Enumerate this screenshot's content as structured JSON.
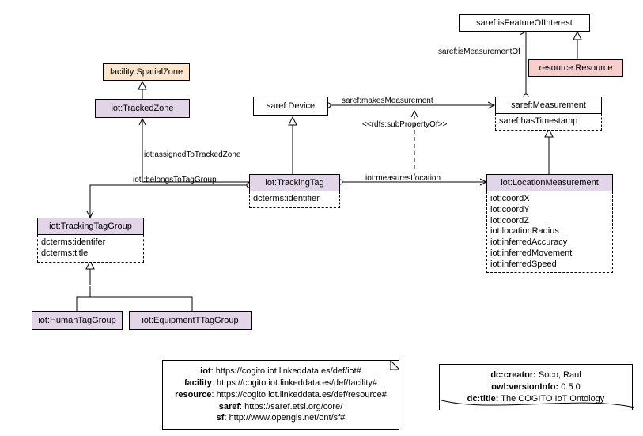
{
  "classes": {
    "spatialZone": "facility:SpatialZone",
    "trackedZone": "iot:TrackedZone",
    "device": "saref:Device",
    "trackingTag": "iot:TrackingTag",
    "trackingTagAttrs": "dcterms:identifier",
    "trackingTagGroup": "iot:TrackingTagGroup",
    "trackingTagGroupAttrs": [
      "dcterms:identifer",
      "dcterms:title"
    ],
    "humanTagGroup": "iot:HumanTagGroup",
    "equipTagGroup": "iot:EquipmentTTagGroup",
    "measurement": "saref:Measurement",
    "measurementAttr": "saref:hasTimestamp",
    "locationMeas": "iot:LocationMeasurement",
    "locationMeasAttrs": [
      "iot:coordX",
      "iot:coordY",
      "iot:coordZ",
      "iot:locationRadius",
      "iot:inferredAccuracy",
      "iot:inferredMovement",
      "iot:inferredSpeed"
    ],
    "isFeature": "saref:isFeatureOfInterest",
    "resource": "resource:Resource"
  },
  "edges": {
    "assignedToTrackedZone": "iot:assignedToTrackedZone",
    "belongsToTagGroup": "iot::belongsToTagGroup",
    "makesMeasurement": "saref:makesMeasurement",
    "subPropOf": "<<rdfs:subPropertyOf>>",
    "measuresLocation": "iot:measuresLocation",
    "isMeasurementOf": "saref:isMeasurementOf"
  },
  "namespaces": {
    "iot": {
      "prefix": "iot",
      "uri": "https://cogito.iot.linkeddata.es/def/iot#"
    },
    "facility": {
      "prefix": "facility",
      "uri": "https://cogito.iot.linkeddata.es/def/facility#"
    },
    "resource": {
      "prefix": "resource",
      "uri": "https://cogito.iot.linkeddata.es/def/resource#"
    },
    "saref": {
      "prefix": "saref",
      "uri": "https://saref.etsi.org/core/"
    },
    "sf": {
      "prefix": "sf",
      "uri": "http://www.opengis.net/ont/sf#"
    }
  },
  "meta": {
    "creator": {
      "k": "dc:creator:",
      "v": "Soco, Raul"
    },
    "version": {
      "k": "owl:versionInfo:",
      "v": "0.5.0"
    },
    "title": {
      "k": "dc:title:",
      "v": "The COGITO IoT Ontology"
    }
  }
}
